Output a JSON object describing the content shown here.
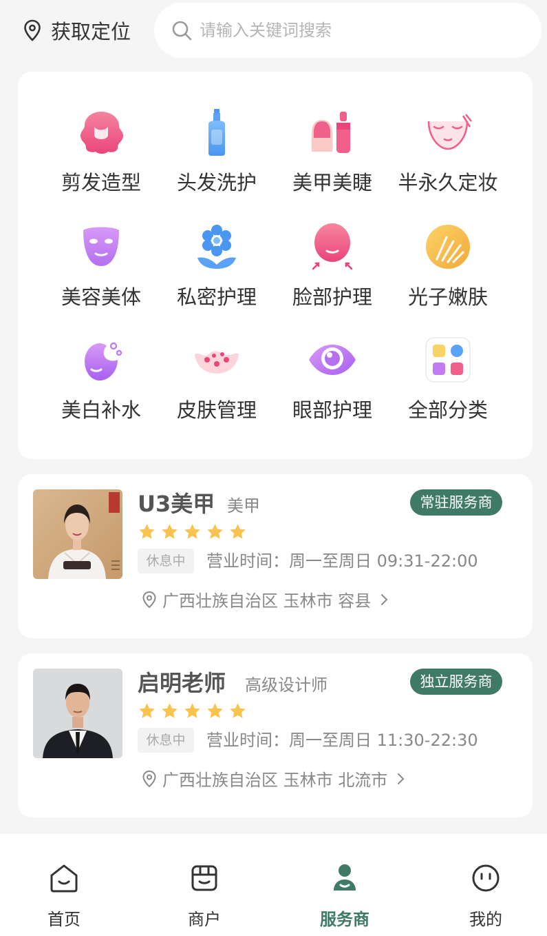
{
  "header": {
    "location_label": "获取定位",
    "search_placeholder": "请输入关键词搜索"
  },
  "categories": [
    {
      "label": "剪发造型",
      "icon": "hair-cut-icon"
    },
    {
      "label": "头发洗护",
      "icon": "shampoo-bottle-icon"
    },
    {
      "label": "美甲美睫",
      "icon": "nail-polish-icon"
    },
    {
      "label": "半永久定妆",
      "icon": "face-makeup-icon"
    },
    {
      "label": "美容美体",
      "icon": "face-mask-icon"
    },
    {
      "label": "私密护理",
      "icon": "flower-icon"
    },
    {
      "label": "脸部护理",
      "icon": "face-lift-icon"
    },
    {
      "label": "光子嫩肤",
      "icon": "photon-icon"
    },
    {
      "label": "美白补水",
      "icon": "whitening-face-icon"
    },
    {
      "label": "皮肤管理",
      "icon": "skin-care-icon"
    },
    {
      "label": "眼部护理",
      "icon": "eye-icon"
    },
    {
      "label": "全部分类",
      "icon": "all-categories-icon"
    }
  ],
  "providers": [
    {
      "name": "U3美甲",
      "role": "美甲",
      "tag": "常驻服务商",
      "rating": 5,
      "status": "休息中",
      "hours": "营业时间：周一至周日 09:31-22:00",
      "address": "广西壮族自治区 玉林市 容县",
      "photo_badge": "留玉满堂"
    },
    {
      "name": "启明老师",
      "role": "高级设计师",
      "tag": "独立服务商",
      "rating": 5,
      "status": "休息中",
      "hours": "营业时间：周一至周日 11:30-22:30",
      "address": "广西壮族自治区 玉林市 北流市"
    }
  ],
  "tabbar": [
    {
      "label": "首页",
      "icon": "home-icon"
    },
    {
      "label": "商户",
      "icon": "store-icon"
    },
    {
      "label": "服务商",
      "icon": "provider-icon",
      "active": true
    },
    {
      "label": "我的",
      "icon": "profile-face-icon"
    }
  ],
  "colors": {
    "accent": "#3f7a67",
    "star": "#f8c44f",
    "pink": "#f0608a",
    "purple": "#c07cf0",
    "blue": "#5aa2f5"
  }
}
